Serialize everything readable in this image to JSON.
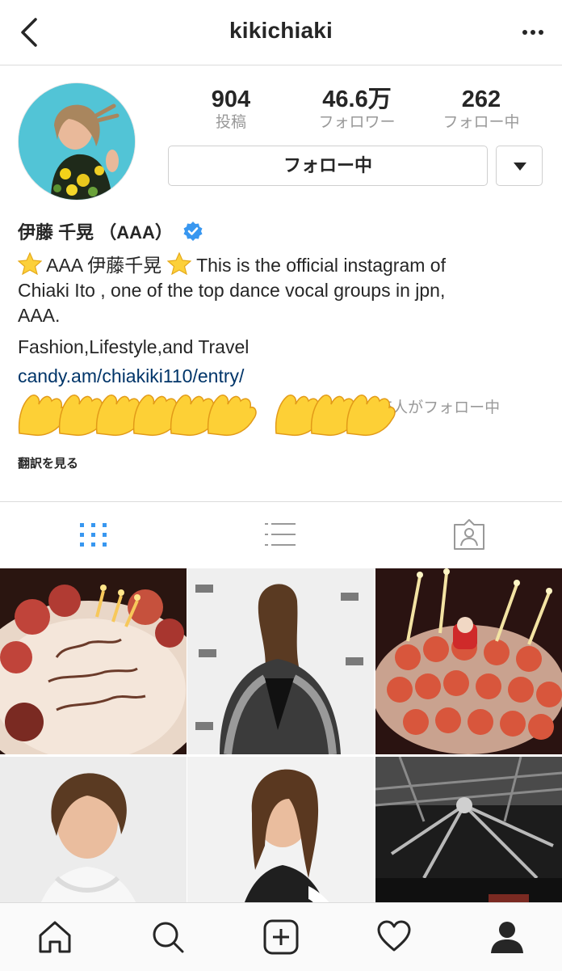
{
  "header": {
    "username": "kikichiaki"
  },
  "stats": [
    {
      "value": "904",
      "label": "投稿"
    },
    {
      "value": "46.6万",
      "label": "フォロワー"
    },
    {
      "value": "262",
      "label": "フォロー中"
    }
  ],
  "actions": {
    "following_label": "フォロー中"
  },
  "profile": {
    "name": "伊藤 千晃 （AAA）",
    "bio_line1": "AAA 伊藤千晃",
    "bio_line1b": " This is the official instagram of",
    "bio_line2": "Chiaki Ito , one of the top dance vocal groups in jpn,",
    "bio_line3": "AAA.",
    "bio_line4": "Fashion,Lifestyle,and Travel",
    "link": "candy.am/chiakiki110/entry/",
    "followed_by": "さん、　　　　さん、　　　　さん、他15人がフォロー中",
    "translate": "翻訳を見る"
  },
  "icons": {
    "back": "chevron-left-icon",
    "more": "more-dots-icon",
    "grid": "grid-icon",
    "list": "list-icon",
    "tagged": "tagged-person-icon",
    "home": "home-icon",
    "search": "search-icon",
    "add": "add-post-icon",
    "activity": "heart-icon",
    "profile": "profile-icon"
  },
  "colors": {
    "accent": "#3897f0",
    "link": "#003569",
    "muted": "#999999"
  }
}
